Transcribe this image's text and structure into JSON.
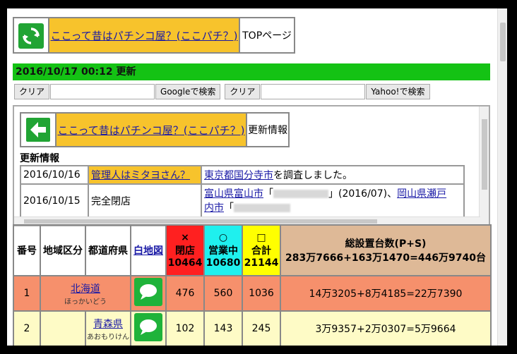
{
  "header": {
    "title_link": "ここって昔はパチンコ屋？(ここパチ？)",
    "top_label": "TOPページ"
  },
  "update_text": "2016/10/17 00:12 更新",
  "search": {
    "clear1": "クリア",
    "google": "Googleで検索",
    "clear2": "クリア",
    "yahoo": "Yahoo!で検索"
  },
  "inner": {
    "title_link": "ここって昔はパチンコ屋？(ここパチ？)",
    "info_label": "更新情報",
    "section": "更新情報",
    "news": [
      {
        "date": "2016/10/16",
        "category": "管理人はミタヨさん？",
        "link": "東京都国分寺市",
        "text": "を調査しました。"
      },
      {
        "date": "2016/10/15",
        "category": "完全閉店",
        "link": "富山県富山市",
        "text_a": "「",
        "text_b": "」(2016/07)、",
        "link2": "岡山県瀬戸",
        "line2_link": "内市",
        "line2_text": "「"
      }
    ]
  },
  "table": {
    "headers": {
      "no": "番号",
      "area": "地域区分",
      "pref": "都道府県",
      "map": "白地図",
      "closed_sym": "×",
      "closed": "閉店",
      "closed_count": "10464",
      "open_sym": "○",
      "open": "営業中",
      "open_count": "10680",
      "sum_sym": "□",
      "sum": "合計",
      "sum_count": "21144",
      "total_title": "総設置台数(P+S)",
      "total_value": "283万7666+163万1470=446万9740台"
    },
    "rows": [
      {
        "no": "1",
        "area": "北海道",
        "kana": "ほっかいどう",
        "closed": "476",
        "open": "560",
        "sum": "1036",
        "total": "14万3205+8万4185=22万7390"
      },
      {
        "no": "2",
        "area": "青森県",
        "kana": "あおもりけん",
        "closed": "102",
        "open": "143",
        "sum": "245",
        "total": "3万9357+2万0307=5万9664"
      }
    ]
  }
}
